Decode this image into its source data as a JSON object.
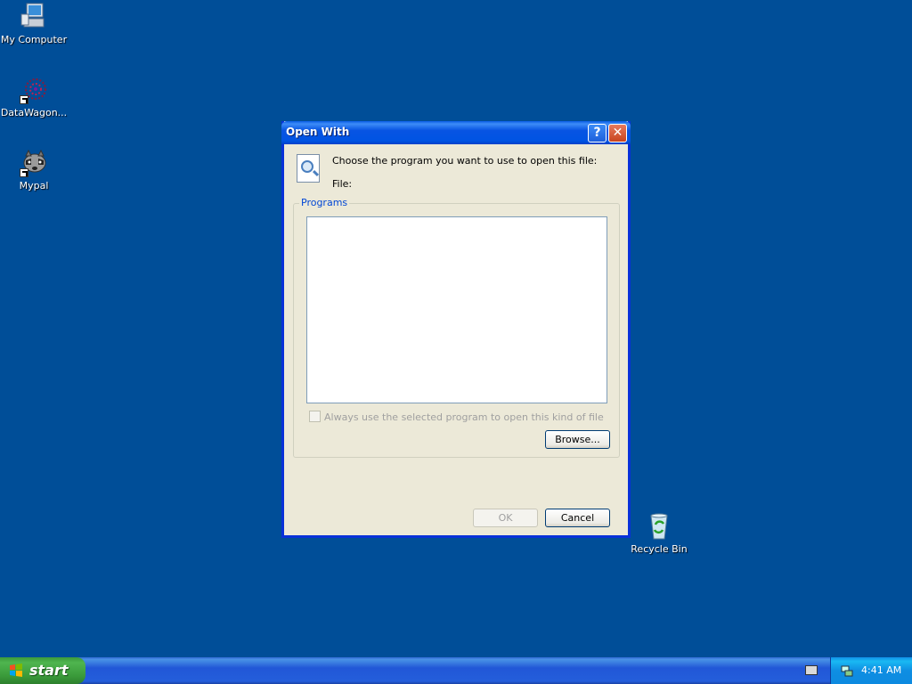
{
  "desktop": {
    "icons": [
      {
        "label": "My Computer"
      },
      {
        "label": "DataWagon..."
      },
      {
        "label": "Mypal"
      },
      {
        "label": "Recycle Bin"
      }
    ]
  },
  "dialog": {
    "title": "Open With",
    "help_glyph": "?",
    "close_glyph": "✕",
    "prompt": "Choose the program you want to use to open this file:",
    "file_label": "File:",
    "programs_group_label": "Programs",
    "always_use_label": "Always use the selected program to open this kind of file",
    "always_use_checked": false,
    "browse_label": "Browse...",
    "ok_label": "OK",
    "cancel_label": "Cancel"
  },
  "taskbar": {
    "start_label": "start",
    "clock": "4:41 AM"
  },
  "colors": {
    "desktop": "#004e98",
    "titlebar": "#0054e3",
    "dialog_bg": "#ece9d8",
    "taskbar": "#245edb",
    "start_green": "#3a9a3a"
  }
}
